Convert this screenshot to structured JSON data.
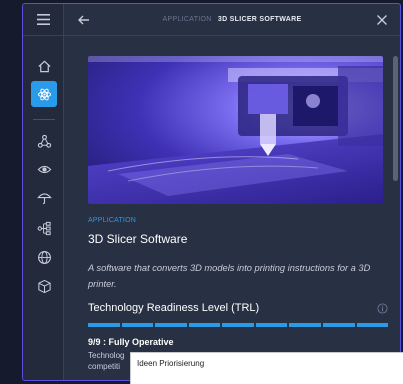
{
  "header": {
    "eyebrow": "APPLICATION",
    "title": "3D SLICER SOFTWARE"
  },
  "detail": {
    "eyebrow": "APPLICATION",
    "title": "3D Slicer Software",
    "description": "A software that converts 3D models into printing instructions for a 3D printer.",
    "trl_label": "Technology Readiness Level (TRL)",
    "trl_value": 9,
    "trl_max": 9,
    "status": "9/9 : Fully Operative",
    "sub_line1": "Technolog",
    "sub_line2": "competiti"
  },
  "popup": {
    "title": "Ideen Priorisierung"
  },
  "colors": {
    "accent": "#2a9be8",
    "frame_border": "#5c4fe0",
    "panel_bg": "#283043"
  },
  "rail_icons": [
    "menu-icon",
    "home-icon",
    "atom-icon",
    "network-icon",
    "eye-icon",
    "umbrella-icon",
    "flow-icon",
    "globe-icon",
    "cube-icon"
  ]
}
